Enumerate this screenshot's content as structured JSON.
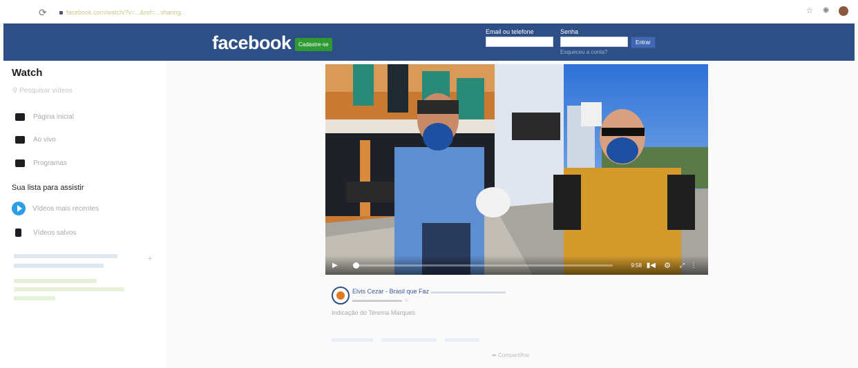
{
  "browser": {
    "url": "facebook.com/watch/?v=...&ref=...sharing...",
    "reload_icon": "reload-icon",
    "icons": [
      "star-icon",
      "extensions-icon",
      "profile-avatar"
    ]
  },
  "header": {
    "logo": "facebook",
    "signup_label": "Cadastre-se",
    "email_label": "Email ou telefone",
    "password_label": "Senha",
    "login_label": "Entrar",
    "forgot_label": "Esqueceu a conta?",
    "colors": {
      "bar": "#2d4f85",
      "signup": "#2f9a32"
    }
  },
  "sidebar": {
    "title": "Watch",
    "search_placeholder": "Pesquisar vídeos",
    "nav": [
      {
        "label": "Página inicial",
        "icon": "play-icon"
      },
      {
        "label": "Ao vivo",
        "icon": "live-icon"
      },
      {
        "label": "Programas",
        "icon": "clapperboard-icon"
      }
    ],
    "section_title": "Sua lista para assistir",
    "watchlist": [
      {
        "label": "Vídeos mais recentes",
        "icon": "play-circle-icon"
      },
      {
        "label": "Vídeos salvos",
        "icon": "bookmark-icon"
      }
    ]
  },
  "video": {
    "time": "9:58",
    "progress": 0.02
  },
  "post": {
    "author": "Elvis Cezar - Brasil que Faz",
    "caption": "Indicação do Terema Marques"
  },
  "actions": {
    "share_label": "Compartilhar"
  }
}
